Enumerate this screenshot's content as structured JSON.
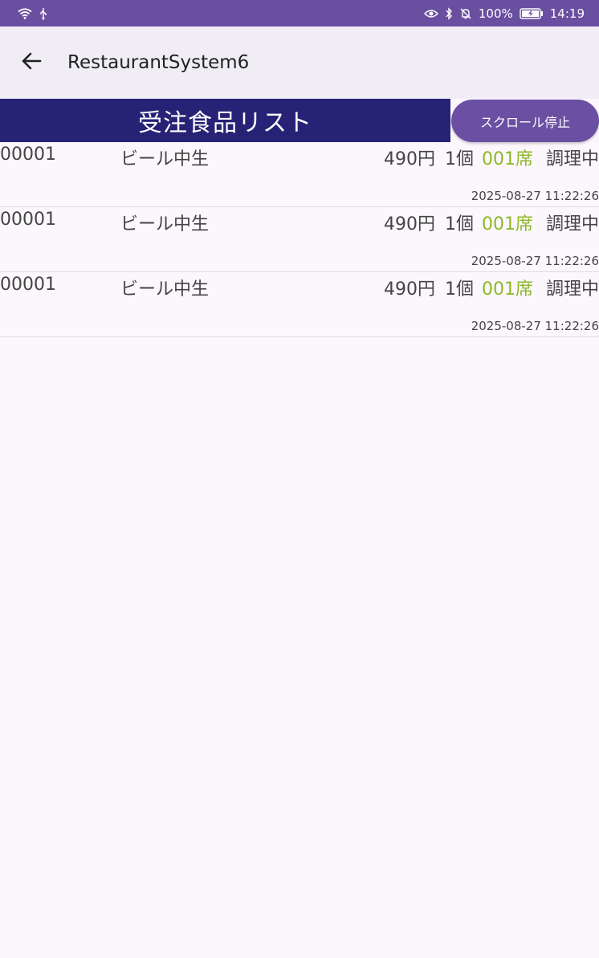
{
  "status_bar": {
    "battery": "100%",
    "time": "14:19"
  },
  "app_bar": {
    "title": "RestaurantSystem6"
  },
  "list_header": {
    "title": "受注食品リスト",
    "scroll_stop_label": "スクロール停止"
  },
  "colors": {
    "status_bar": "#6a4fa0",
    "header": "#262276",
    "accent_button": "#6b4fa3",
    "seat_text": "#8db82a",
    "background": "#fcf7fd"
  },
  "orders": [
    {
      "id": "00001",
      "name": "ビール中生",
      "price": "490円",
      "qty": "1個",
      "seat": "001席",
      "status": "調理中",
      "time": "2025-08-27 11:22:26"
    },
    {
      "id": "00001",
      "name": "ビール中生",
      "price": "490円",
      "qty": "1個",
      "seat": "001席",
      "status": "調理中",
      "time": "2025-08-27 11:22:26"
    },
    {
      "id": "00001",
      "name": "ビール中生",
      "price": "490円",
      "qty": "1個",
      "seat": "001席",
      "status": "調理中",
      "time": "2025-08-27 11:22:26"
    }
  ]
}
